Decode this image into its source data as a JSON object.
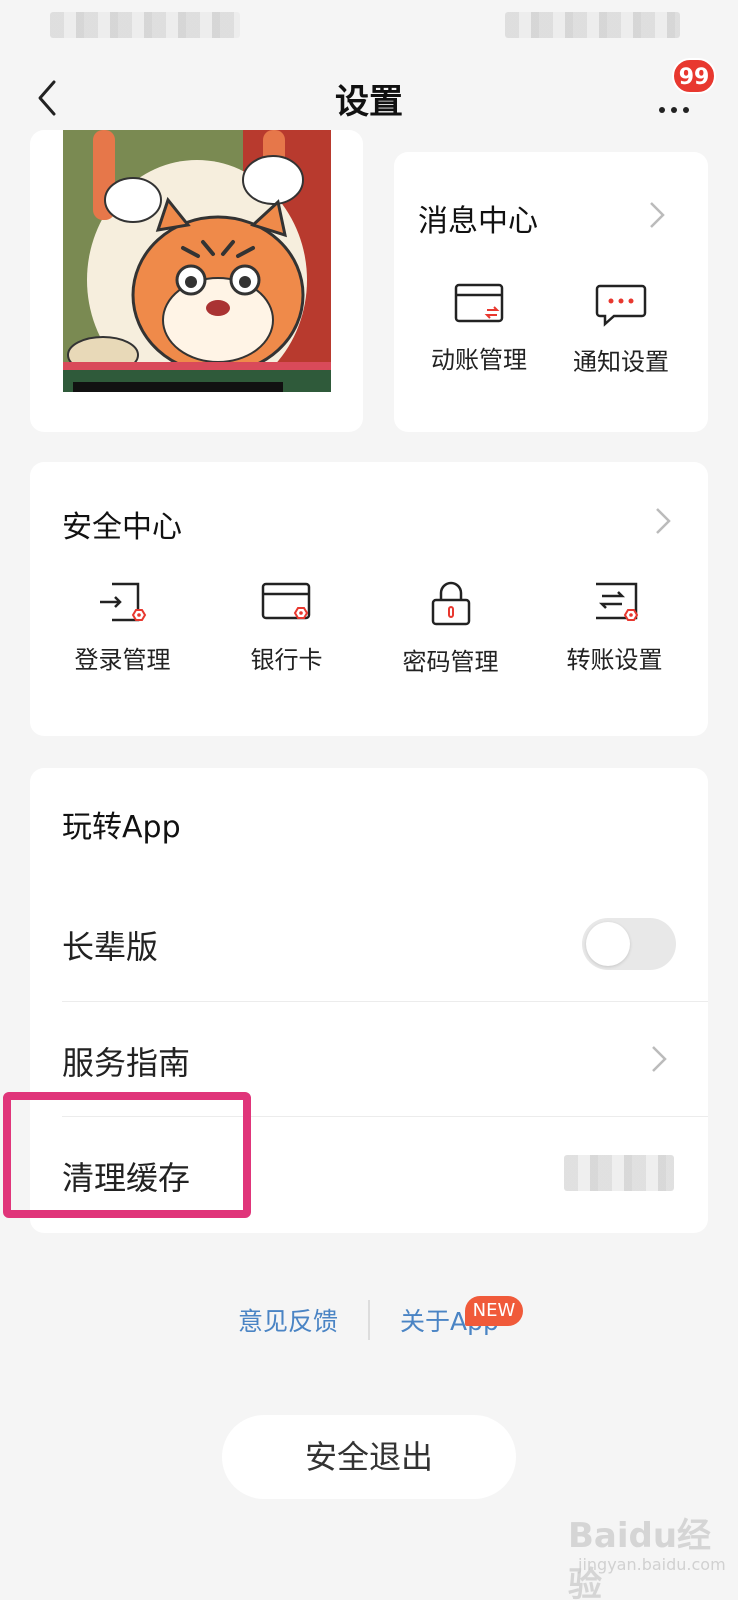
{
  "nav": {
    "title": "设置",
    "badge_count": "99"
  },
  "message_center": {
    "title": "消息中心",
    "items": [
      {
        "label": "动账管理",
        "icon": "transaction-card-icon"
      },
      {
        "label": "通知设置",
        "icon": "chat-bubble-icon"
      }
    ]
  },
  "security_center": {
    "title": "安全中心",
    "items": [
      {
        "label": "登录管理",
        "icon": "login-shield-icon"
      },
      {
        "label": "银行卡",
        "icon": "bank-card-icon"
      },
      {
        "label": "密码管理",
        "icon": "lock-icon"
      },
      {
        "label": "转账设置",
        "icon": "transfer-icon"
      }
    ]
  },
  "play_app": {
    "title": "玩转App",
    "rows": [
      {
        "label": "长辈版",
        "control": "toggle",
        "on": false
      },
      {
        "label": "服务指南",
        "control": "chevron"
      },
      {
        "label": "清理缓存",
        "control": "value"
      }
    ]
  },
  "footer": {
    "feedback": "意见反馈",
    "about": "关于App",
    "new_badge": "NEW",
    "logout": "安全退出"
  },
  "watermark": {
    "brand": "Baidu经验",
    "url": "jingyan.baidu.com"
  },
  "colors": {
    "accent_red": "#e8382f",
    "link_blue": "#4a84c4",
    "highlight_pink": "#e0357a"
  }
}
